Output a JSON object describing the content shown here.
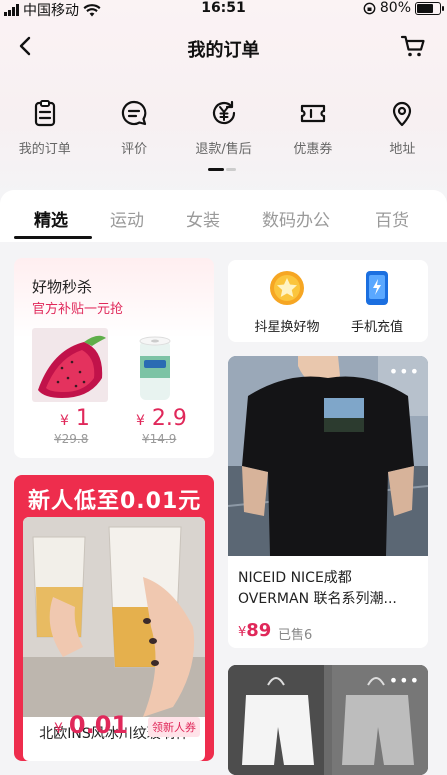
{
  "status_bar": {
    "carrier": "中国移动",
    "time": "16:51",
    "battery": "80%",
    "battery_level": 0.8
  },
  "header": {
    "title": "我的订单"
  },
  "quick_menu": [
    {
      "label": "我的订单",
      "icon": "clipboard-icon"
    },
    {
      "label": "评价",
      "icon": "comment-icon"
    },
    {
      "label": "退款/售后",
      "icon": "refund-icon"
    },
    {
      "label": "优惠券",
      "icon": "coupon-icon"
    },
    {
      "label": "地址",
      "icon": "location-icon"
    }
  ],
  "categories": [
    "精选",
    "运动",
    "女装",
    "数码办公",
    "百货"
  ],
  "flash_sale": {
    "title": "好物秒杀",
    "subtitle": "官方补贴一元抢",
    "items": [
      {
        "currency": "¥",
        "price": "1",
        "original": "¥29.8"
      },
      {
        "currency": "¥",
        "price": "2.9",
        "original": "¥14.9"
      }
    ]
  },
  "promos": [
    {
      "label": "抖星换好物",
      "icon": "star-icon"
    },
    {
      "label": "手机充值",
      "icon": "phone-charge-icon"
    }
  ],
  "new_user": {
    "banner": "新人低至0.01元",
    "product_name": "北欧INS风冰川纹玻璃杯",
    "currency": "¥",
    "price": "0.01",
    "coupon": "领新人券"
  },
  "product": {
    "title": "NICEID NICE成都OVERMAN 联名系列潮...",
    "currency": "¥",
    "price": "89",
    "sold": "已售6"
  },
  "colors": {
    "accent": "#e0285a",
    "banner_red": "#ee2d4d"
  }
}
